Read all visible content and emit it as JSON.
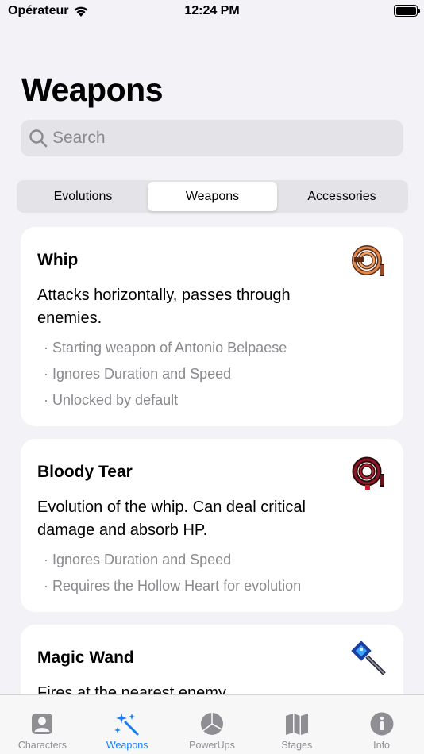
{
  "status_bar": {
    "carrier": "Opérateur",
    "time": "12:24 PM"
  },
  "header": {
    "title": "Weapons"
  },
  "search": {
    "placeholder": "Search"
  },
  "segments": {
    "items": [
      "Evolutions",
      "Weapons",
      "Accessories"
    ],
    "selected": "Weapons"
  },
  "cards": [
    {
      "title": "Whip",
      "description": "Attacks horizontally, passes through enemies.",
      "notes": [
        "Starting weapon of Antonio Belpaese",
        "Ignores Duration and Speed",
        "Unlocked by default"
      ],
      "icon": "whip-sprite-icon"
    },
    {
      "title": "Bloody Tear",
      "description": "Evolution of the whip. Can deal critical damage and absorb HP.",
      "notes": [
        "Ignores Duration and Speed",
        "Requires the Hollow Heart for evolution"
      ],
      "icon": "bloody-tear-sprite-icon"
    },
    {
      "title": "Magic Wand",
      "description": "Fires at the nearest enemy.",
      "notes": [],
      "icon": "magic-wand-sprite-icon"
    }
  ],
  "tab_bar": {
    "items": [
      {
        "label": "Characters",
        "icon": "person-icon"
      },
      {
        "label": "Weapons",
        "icon": "sparkles-wand-icon"
      },
      {
        "label": "PowerUps",
        "icon": "pie-chart-icon"
      },
      {
        "label": "Stages",
        "icon": "map-icon"
      },
      {
        "label": "Info",
        "icon": "info-icon"
      }
    ],
    "active": "Weapons"
  },
  "colors": {
    "accent": "#1a7cf5",
    "background": "#f2f2f7",
    "secondary_text": "#8a8a8e"
  }
}
